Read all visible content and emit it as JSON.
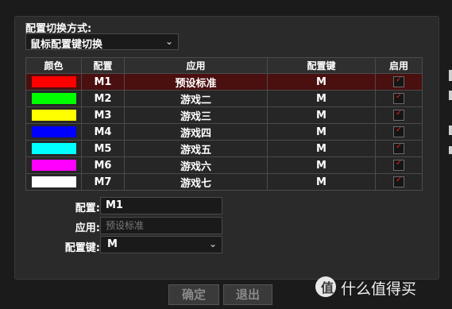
{
  "switch_section": {
    "label": "配置切换方式:",
    "mode_value": "鼠标配置键切换"
  },
  "table": {
    "headers": [
      "颜色",
      "配置",
      "应用",
      "配置键",
      "启用"
    ],
    "rows": [
      {
        "color": "#ff0000",
        "profile": "M1",
        "app": "预设标准",
        "key": "M",
        "enabled": true,
        "selected": true
      },
      {
        "color": "#00ff00",
        "profile": "M2",
        "app": "游戏二",
        "key": "M",
        "enabled": true,
        "selected": false
      },
      {
        "color": "#ffff00",
        "profile": "M3",
        "app": "游戏三",
        "key": "M",
        "enabled": true,
        "selected": false
      },
      {
        "color": "#0000ff",
        "profile": "M4",
        "app": "游戏四",
        "key": "M",
        "enabled": true,
        "selected": false
      },
      {
        "color": "#00ffff",
        "profile": "M5",
        "app": "游戏五",
        "key": "M",
        "enabled": true,
        "selected": false
      },
      {
        "color": "#ff00ff",
        "profile": "M6",
        "app": "游戏六",
        "key": "M",
        "enabled": true,
        "selected": false
      },
      {
        "color": "#ffffff",
        "profile": "M7",
        "app": "游戏七",
        "key": "M",
        "enabled": true,
        "selected": false
      }
    ],
    "selected_row_color": "#4a0f0f",
    "check_color": "#e02020"
  },
  "form": {
    "profile_label": "配置:",
    "profile_value": "M1",
    "app_label": "应用:",
    "app_placeholder": "预设标准",
    "key_label": "配置键:",
    "key_value": "M"
  },
  "buttons": {
    "confirm": "确定",
    "exit": "退出"
  },
  "watermark": {
    "logo_char": "值",
    "text": "什么值得买"
  }
}
